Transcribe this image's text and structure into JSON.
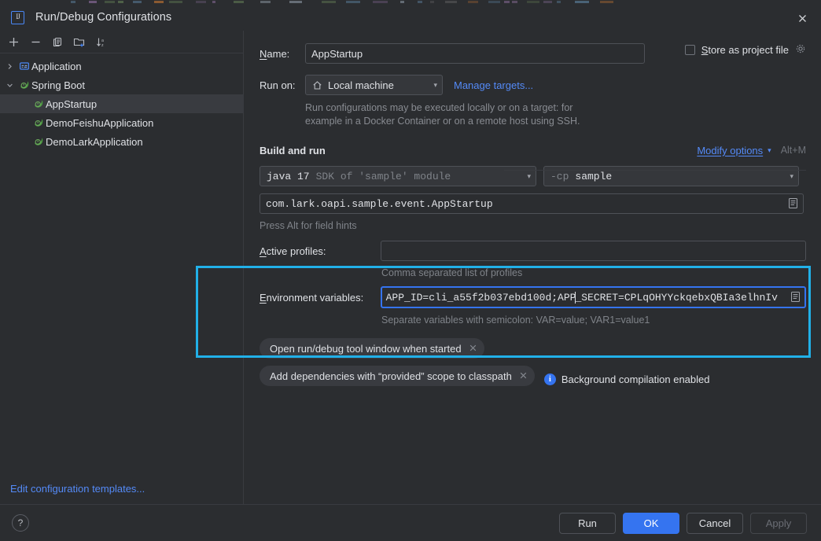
{
  "window": {
    "title": "Run/Debug Configurations",
    "logo_icon": "intellij-idea-logo",
    "close_icon": "close-icon"
  },
  "toolbar": {
    "buttons": [
      {
        "name": "add-configuration",
        "icon": "plus-icon",
        "glyph": "+"
      },
      {
        "name": "remove-configuration",
        "icon": "minus-icon",
        "glyph": "−"
      },
      {
        "name": "copy-configuration",
        "icon": "copy-icon",
        "glyph": "⧉"
      },
      {
        "name": "new-folder",
        "icon": "new-folder-icon",
        "glyph": "Ὄ1"
      },
      {
        "name": "sort-configurations",
        "icon": "sort-alphabetical-icon",
        "glyph": "↓"
      }
    ]
  },
  "tree": {
    "items": [
      {
        "label": "Application",
        "depth": 1,
        "twisty": "›",
        "icon": "application-icon",
        "selected": false
      },
      {
        "label": "Spring Boot",
        "depth": 1,
        "twisty": "⌄",
        "icon": "spring-boot-icon",
        "selected": false
      },
      {
        "label": "AppStartup",
        "depth": 2,
        "twisty": "",
        "icon": "spring-boot-icon",
        "selected": true
      },
      {
        "label": "DemoFeishuApplication",
        "depth": 2,
        "twisty": "",
        "icon": "spring-boot-icon",
        "selected": false
      },
      {
        "label": "DemoLarkApplication",
        "depth": 2,
        "twisty": "",
        "icon": "spring-boot-icon",
        "selected": false
      }
    ],
    "edit_templates_link": "Edit configuration templates..."
  },
  "form": {
    "name_label_pre": "N",
    "name_label_post": "ame:",
    "name_value": "AppStartup",
    "store_as_project_file_pre": "S",
    "store_as_project_file_post": "tore as project file",
    "store_gear_icon": "gear-icon",
    "run_on_label": "Run on:",
    "run_on_value": "Local machine",
    "run_on_icon": "home-icon",
    "manage_targets_link": "Manage targets...",
    "target_hint_line1": "Run configurations may be executed locally or on a target: for",
    "target_hint_line2": "example in a Docker Container or on a remote host using SSH.",
    "build_and_run_title": "Build and run",
    "modify_options_link": "Modify options",
    "modify_options_shortcut": "Alt+M",
    "jdk_name": "java 17",
    "jdk_desc": "SDK of 'sample' module",
    "cp_flag": "-cp",
    "cp_module": "sample",
    "main_class": "com.lark.oapi.sample.event.AppStartup",
    "main_class_icon": "expand-editor-icon",
    "alt_hint": "Press Alt for field hints",
    "active_profiles_label_pre": "A",
    "active_profiles_label_post": "ctive profiles:",
    "active_profiles_value": "",
    "active_profiles_hint": "Comma separated list of profiles",
    "env_label_pre": "E",
    "env_label_post": "nvironment variables:",
    "env_value_before_caret": "APP_ID=cli_a55f2b037ebd100d;APP",
    "env_value_after_caret": "_SECRET=CPLqOHYYckqebxQBIa3elhnIv",
    "env_icon": "expand-editor-icon",
    "env_hint": "Separate variables with semicolon: VAR=value; VAR1=value1",
    "chips": [
      {
        "label": "Open run/debug tool window when started",
        "close_icon": "close-chip-icon"
      },
      {
        "label": "Add dependencies with “provided” scope to classpath",
        "close_icon": "close-chip-icon"
      }
    ],
    "background_note": "Background compilation enabled",
    "background_note_icon": "info-icon"
  },
  "footer": {
    "help_icon": "help-icon",
    "help_glyph": "?",
    "buttons": [
      {
        "label": "Run",
        "style": "normal"
      },
      {
        "label": "OK",
        "style": "primary"
      },
      {
        "label": "Cancel",
        "style": "normal"
      },
      {
        "label": "Apply",
        "style": "disabled"
      }
    ]
  },
  "annotation": {
    "color": "#21b0e8",
    "shape": "rectangle-highlight"
  },
  "colors": {
    "background": "#2b2d30",
    "accent": "#3574f0",
    "link": "#548af7",
    "selection": "#393b40",
    "highlight": "#21b0e8"
  }
}
